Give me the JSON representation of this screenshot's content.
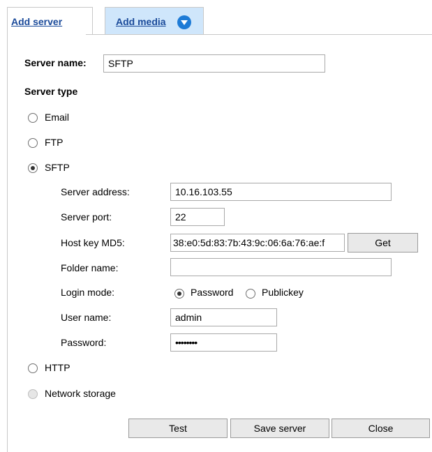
{
  "tabs": {
    "add_server": "Add server",
    "add_media": "Add media"
  },
  "server_name": {
    "label": "Server name:",
    "value": "SFTP"
  },
  "server_type": {
    "label": "Server type",
    "options": [
      {
        "label": "Email",
        "selected": false,
        "disabled": false
      },
      {
        "label": "FTP",
        "selected": false,
        "disabled": false
      },
      {
        "label": "SFTP",
        "selected": true,
        "disabled": false
      },
      {
        "label": "HTTP",
        "selected": false,
        "disabled": false
      },
      {
        "label": "Network storage",
        "selected": false,
        "disabled": true
      }
    ]
  },
  "sftp": {
    "server_address": {
      "label": "Server address:",
      "value": "10.16.103.55"
    },
    "server_port": {
      "label": "Server port:",
      "value": "22"
    },
    "host_key": {
      "label": "Host key MD5:",
      "value": "38:e0:5d:83:7b:43:9c:06:6a:76:ae:f",
      "get_button": "Get"
    },
    "folder_name": {
      "label": "Folder name:",
      "value": ""
    },
    "login_mode": {
      "label": "Login mode:",
      "options": [
        "Password",
        "Publickey"
      ],
      "selected": "Password"
    },
    "user_name": {
      "label": "User name:",
      "value": "admin"
    },
    "password": {
      "label": "Password:",
      "value": "••••••••"
    }
  },
  "buttons": {
    "test": "Test",
    "save": "Save server",
    "close": "Close"
  },
  "colors": {
    "tab_link": "#1a4a9a",
    "tab_active_bg": "#cfe6fb",
    "chevron": "#1e7bd6"
  }
}
